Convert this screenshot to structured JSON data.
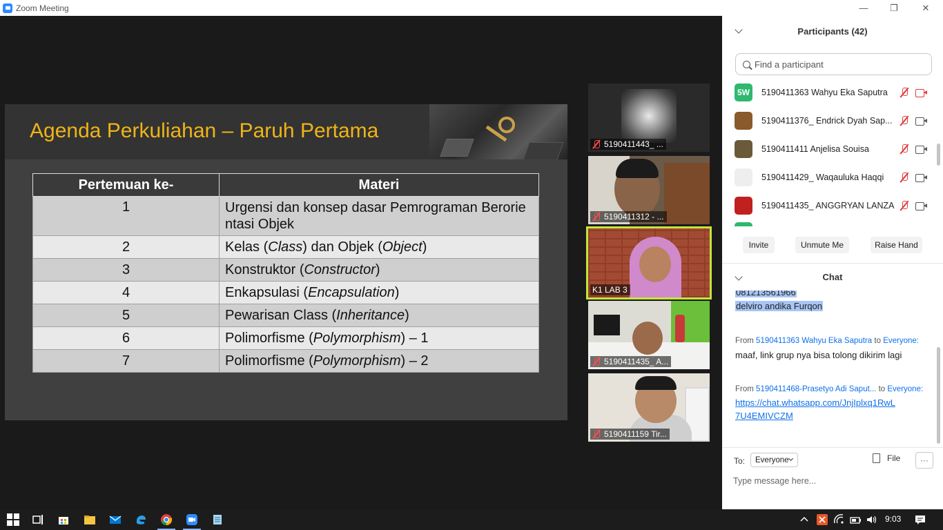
{
  "window": {
    "title": "Zoom Meeting",
    "minimize": "—",
    "restore": "❐",
    "close": "✕"
  },
  "slide": {
    "title": "Agenda Perkuliahan – Paruh Pertama",
    "table": {
      "headers": [
        "Pertemuan ke-",
        "Materi"
      ],
      "rows": [
        {
          "num": "1",
          "pre": "Urgensi dan konsep dasar Pemrograman Berorie ntasi Objek",
          "em": "",
          "post": ""
        },
        {
          "num": "2",
          "pre": "Kelas (",
          "em": "Class",
          "post": ") dan Objek (",
          "em2": "Object",
          "post2": ")"
        },
        {
          "num": "3",
          "pre": "Konstruktor (",
          "em": "Constructor",
          "post": ")"
        },
        {
          "num": "4",
          "pre": "Enkapsulasi (",
          "em": "Encapsulation",
          "post": ")"
        },
        {
          "num": "5",
          "pre": "Pewarisan Class (",
          "em": "Inheritance",
          "post": ")"
        },
        {
          "num": "6",
          "pre": "Polimorfisme (",
          "em": "Polymorphism",
          "post": ") – 1"
        },
        {
          "num": "7",
          "pre": "Polimorfisme (",
          "em": "Polymorphism",
          "post": ") – 2"
        }
      ]
    }
  },
  "videos": [
    {
      "label": "5190411443_ ...",
      "muted": true
    },
    {
      "label": "5190411312 - ...",
      "muted": true
    },
    {
      "label": "K1 LAB 3",
      "muted": false
    },
    {
      "label": "5190411435_ A...",
      "muted": true
    },
    {
      "label": "5190411159 Tir...",
      "muted": true
    }
  ],
  "participants": {
    "header": "Participants (42)",
    "search_placeholder": "Find a participant",
    "list": [
      {
        "initials": "5W",
        "avatar_color": "#2fb86e",
        "name": "5190411363 Wahyu Eka Saputra",
        "video_off": true
      },
      {
        "initials": "",
        "avatar_color": "#8a5a2b",
        "name": "5190411376_ Endrick Dyah Sap...",
        "video_off": false
      },
      {
        "initials": "",
        "avatar_color": "#6b5a3a",
        "name": "5190411411 Anjelisa Souisa",
        "video_off": false
      },
      {
        "initials": "",
        "avatar_color": "#eeeeee",
        "name": "5190411429_ Waqauluka Haqqi",
        "video_off": false
      },
      {
        "initials": "",
        "avatar_color": "#c02020",
        "name": "5190411435_ ANGGRYAN LANZA",
        "video_off": false
      }
    ],
    "buttons": {
      "invite": "Invite",
      "unmute": "Unmute Me",
      "raise_hand": "Raise Hand"
    }
  },
  "chat": {
    "header": "Chat",
    "highlighted": [
      "081213561966",
      "delviro andika Furqon"
    ],
    "messages": [
      {
        "from_label": "From",
        "from": "5190411363 Wahyu Eka Saputra",
        "to_label": "to",
        "to": "Everyone:",
        "text": "maaf, link grup nya bisa tolong dikirim lagi"
      },
      {
        "from_label": "From",
        "from": "5190411468-Prasetyo Adi Saput...",
        "to_label": "to",
        "to": "Everyone:",
        "text": "https://chat.whatsapp.com/JnjIplxq1RwL 7U4EMIVCZM"
      }
    ],
    "to_label": "To:",
    "to_value": "Everyone",
    "file_label": "File",
    "more_label": "···",
    "input_placeholder": "Type message here..."
  },
  "taskbar": {
    "clock": "9:03"
  }
}
